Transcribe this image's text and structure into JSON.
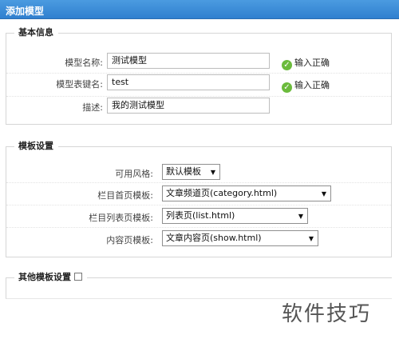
{
  "dialog": {
    "title": "添加模型"
  },
  "basic": {
    "legend": "基本信息",
    "name_label": "模型名称:",
    "name_value": "测试模型",
    "name_status": "输入正确",
    "table_label": "模型表键名:",
    "table_value": "test",
    "table_status": "输入正确",
    "desc_label": "描述:",
    "desc_value": "我的测试模型"
  },
  "template": {
    "legend": "模板设置",
    "style_label": "可用风格:",
    "style_value": "默认模板",
    "category_label": "栏目首页模板:",
    "category_value": "文章频道页(category.html)",
    "list_label": "栏目列表页模板:",
    "list_value": "列表页(list.html)",
    "show_label": "内容页模板:",
    "show_value": "文章内容页(show.html)"
  },
  "other": {
    "legend": "其他模板设置"
  },
  "watermark": "软件技巧",
  "icons": {
    "ok": "check-circle-icon",
    "dropdown": "triangle-down-icon"
  },
  "colors": {
    "titlebar": "#2f7fcf",
    "ok": "#6bbb3c"
  }
}
